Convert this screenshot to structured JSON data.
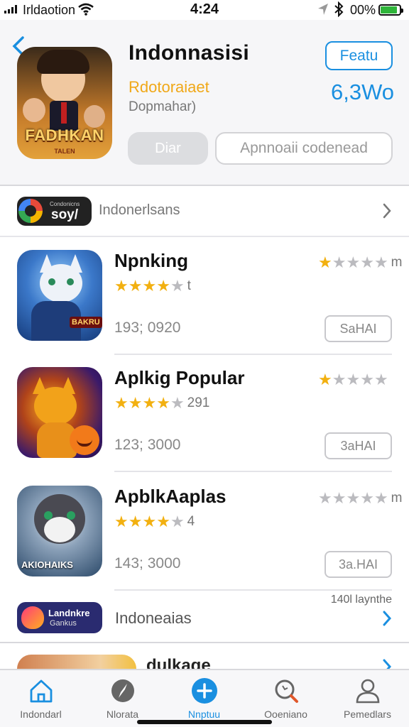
{
  "status_bar": {
    "carrier": "Irldaotion",
    "time": "4:24",
    "battery": "00%",
    "battery_level": 0.9,
    "icons": [
      "signal-icon",
      "wifi-icon",
      "location-icon",
      "bluetooth-icon",
      "battery-icon"
    ]
  },
  "header": {
    "back_icon": "chevron-left-icon",
    "app_icon_text": "FADHKAN",
    "app_icon_subtext": "TALEN",
    "title": "Indonnasisi",
    "subtitle": "Rdotoraiaet",
    "developer": "Dopmahar)",
    "feature_button": "Featu",
    "price": "6,3Wo",
    "grey_button": "Diar",
    "outline_button": "Apnnoaii codenead"
  },
  "category_row": {
    "pill_small": "Condonicns",
    "pill_big": "soy/",
    "label": "Indonerlsans"
  },
  "apps": [
    {
      "name": "Npnking",
      "rating": 3.5,
      "rating_note": "t",
      "right_rating": 1,
      "right_note": "m",
      "count": "193; 0920",
      "button": "SaHAI",
      "icon_tag": "BAKRU"
    },
    {
      "name": "Aplkig Popular",
      "rating": 4,
      "rating_note": "291",
      "right_rating": 1,
      "right_note": "",
      "count": "123; 3000",
      "button": "3aHAI",
      "icon_tag": ""
    },
    {
      "name": "ApblkAaplas",
      "rating": 3.5,
      "rating_note": "4",
      "right_rating": 0,
      "right_note": "m",
      "count": "143; 3000",
      "button": "3a.HAI",
      "icon_tag": "AKIOHAIKS"
    }
  ],
  "promo_row": {
    "corner_text": "140l laynthe",
    "pill_line1": "Landnkre",
    "pill_line2": "Gankus",
    "label": "Indoneaias"
  },
  "peek_row": {
    "label": "dulkage"
  },
  "tabs": [
    {
      "label": "Indondarl",
      "icon": "home-icon",
      "active": false
    },
    {
      "label": "Nlorata",
      "icon": "compass-icon",
      "active": false
    },
    {
      "label": "Nnptuu",
      "icon": "plus-circle-icon",
      "active": true
    },
    {
      "label": "Ooeniano",
      "icon": "search-icon",
      "active": false
    },
    {
      "label": "Pemedlars",
      "icon": "person-icon",
      "active": false
    }
  ],
  "colors": {
    "accent": "#1a8fe0",
    "star": "#f2b010",
    "subtitle": "#f0a818"
  }
}
